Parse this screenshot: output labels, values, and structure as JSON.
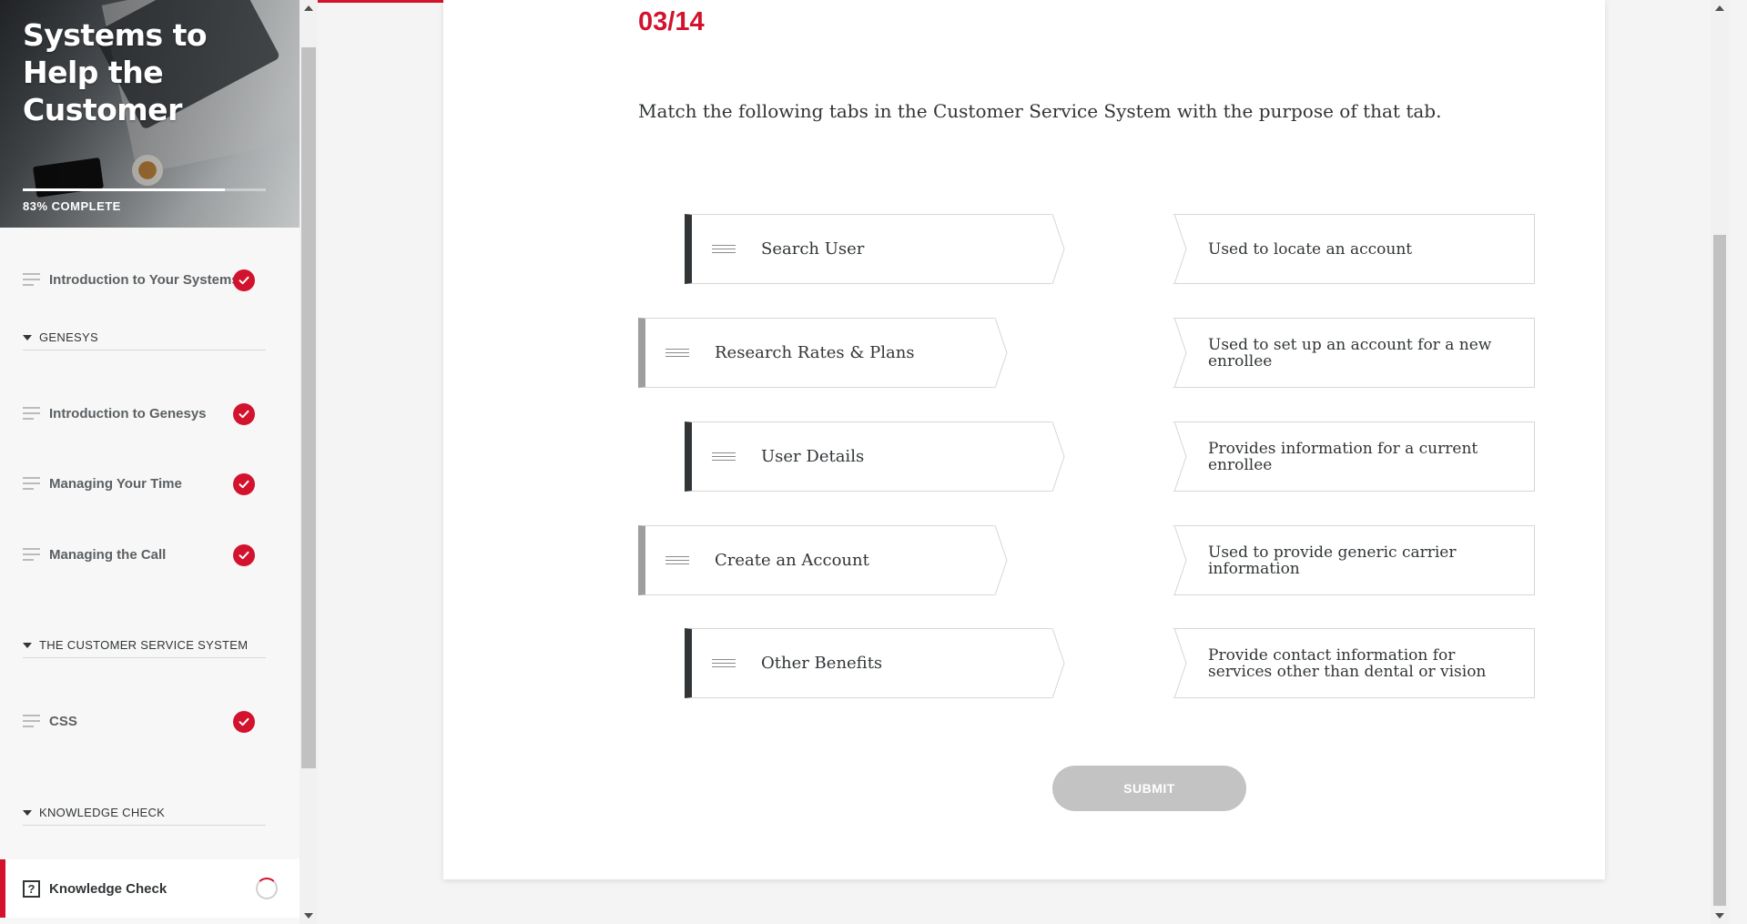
{
  "course": {
    "title": "Systems to Help the Customer",
    "progress_percent": 83,
    "progress_label": "83% COMPLETE"
  },
  "sidebar": {
    "items": [
      {
        "type": "lesson",
        "label": "Introduction to Your Systems",
        "status": "complete"
      },
      {
        "type": "section",
        "label": "GENESYS"
      },
      {
        "type": "lesson",
        "label": "Introduction to Genesys",
        "status": "complete"
      },
      {
        "type": "lesson",
        "label": "Managing Your Time",
        "status": "complete"
      },
      {
        "type": "lesson",
        "label": "Managing the Call",
        "status": "complete"
      },
      {
        "type": "section",
        "label": "THE CUSTOMER SERVICE SYSTEM"
      },
      {
        "type": "lesson",
        "label": "CSS",
        "status": "complete"
      },
      {
        "type": "section",
        "label": "KNOWLEDGE CHECK"
      },
      {
        "type": "quiz",
        "label": "Knowledge Check",
        "status": "in-progress",
        "icon": "question-box-icon",
        "icon_glyph": "?"
      }
    ]
  },
  "quiz": {
    "counter": "03/14",
    "question": "Match the following tabs in the Customer Service System with the purpose of that tab.",
    "tabs": [
      {
        "label": "Search User"
      },
      {
        "label": "Research Rates & Plans"
      },
      {
        "label": "User Details"
      },
      {
        "label": "Create an Account"
      },
      {
        "label": "Other Benefits"
      }
    ],
    "purposes": [
      {
        "label": "Used to locate an account"
      },
      {
        "label": "Used to set up an account for a new enrollee"
      },
      {
        "label": "Provides information for a current enrollee"
      },
      {
        "label": "Used to provide generic carrier information"
      },
      {
        "label": "Provide contact information for services other than dental or vision"
      }
    ],
    "submit_label": "SUBMIT"
  },
  "colors": {
    "accent": "#d3122d",
    "dark": "#313537",
    "disabled": "#c3c3c3"
  }
}
